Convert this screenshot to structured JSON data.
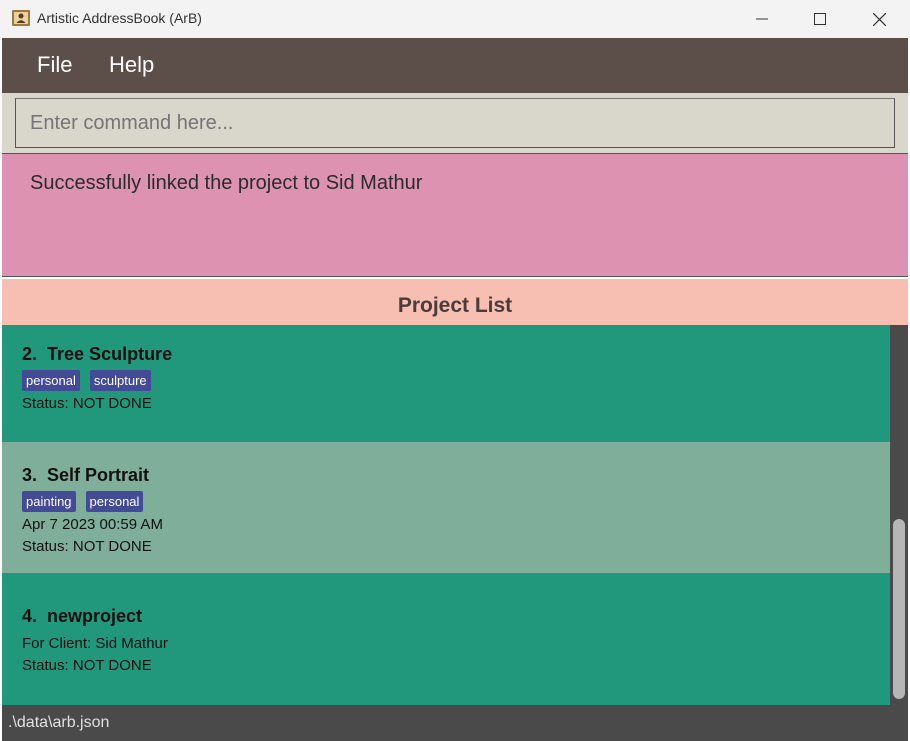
{
  "window": {
    "title": "Artistic AddressBook (ArB)",
    "minimize_icon": "minimize-icon",
    "maximize_icon": "maximize-icon",
    "close_icon": "close-icon"
  },
  "menu": {
    "file": "File",
    "help": "Help"
  },
  "command": {
    "placeholder": "Enter command here...",
    "value": ""
  },
  "result": {
    "message": "Successfully linked the project to Sid Mathur"
  },
  "project_list": {
    "header": "Project List",
    "items": [
      {
        "index": "2.",
        "name": "Tree Sculpture",
        "tags": [
          "personal",
          "sculpture"
        ],
        "deadline": "",
        "client": "",
        "status": "Status: NOT DONE",
        "color": "#21977b"
      },
      {
        "index": "3.",
        "name": "Self Portrait",
        "tags": [
          "painting",
          "personal"
        ],
        "deadline": "Apr 7 2023 00:59 AM",
        "client": "",
        "status": "Status: NOT DONE",
        "color": "#7faf9b"
      },
      {
        "index": "4.",
        "name": "newproject",
        "tags": [],
        "deadline": "",
        "client": "For Client: Sid Mathur",
        "status": "Status: NOT DONE",
        "color": "#21977b"
      }
    ]
  },
  "status_bar": {
    "path": ".\\data\\arb.json"
  },
  "colors": {
    "menubar": "#5c4f4a",
    "result_bg": "#de92b1",
    "header_bg": "#f7beb2",
    "tag_bg": "#434a96"
  }
}
